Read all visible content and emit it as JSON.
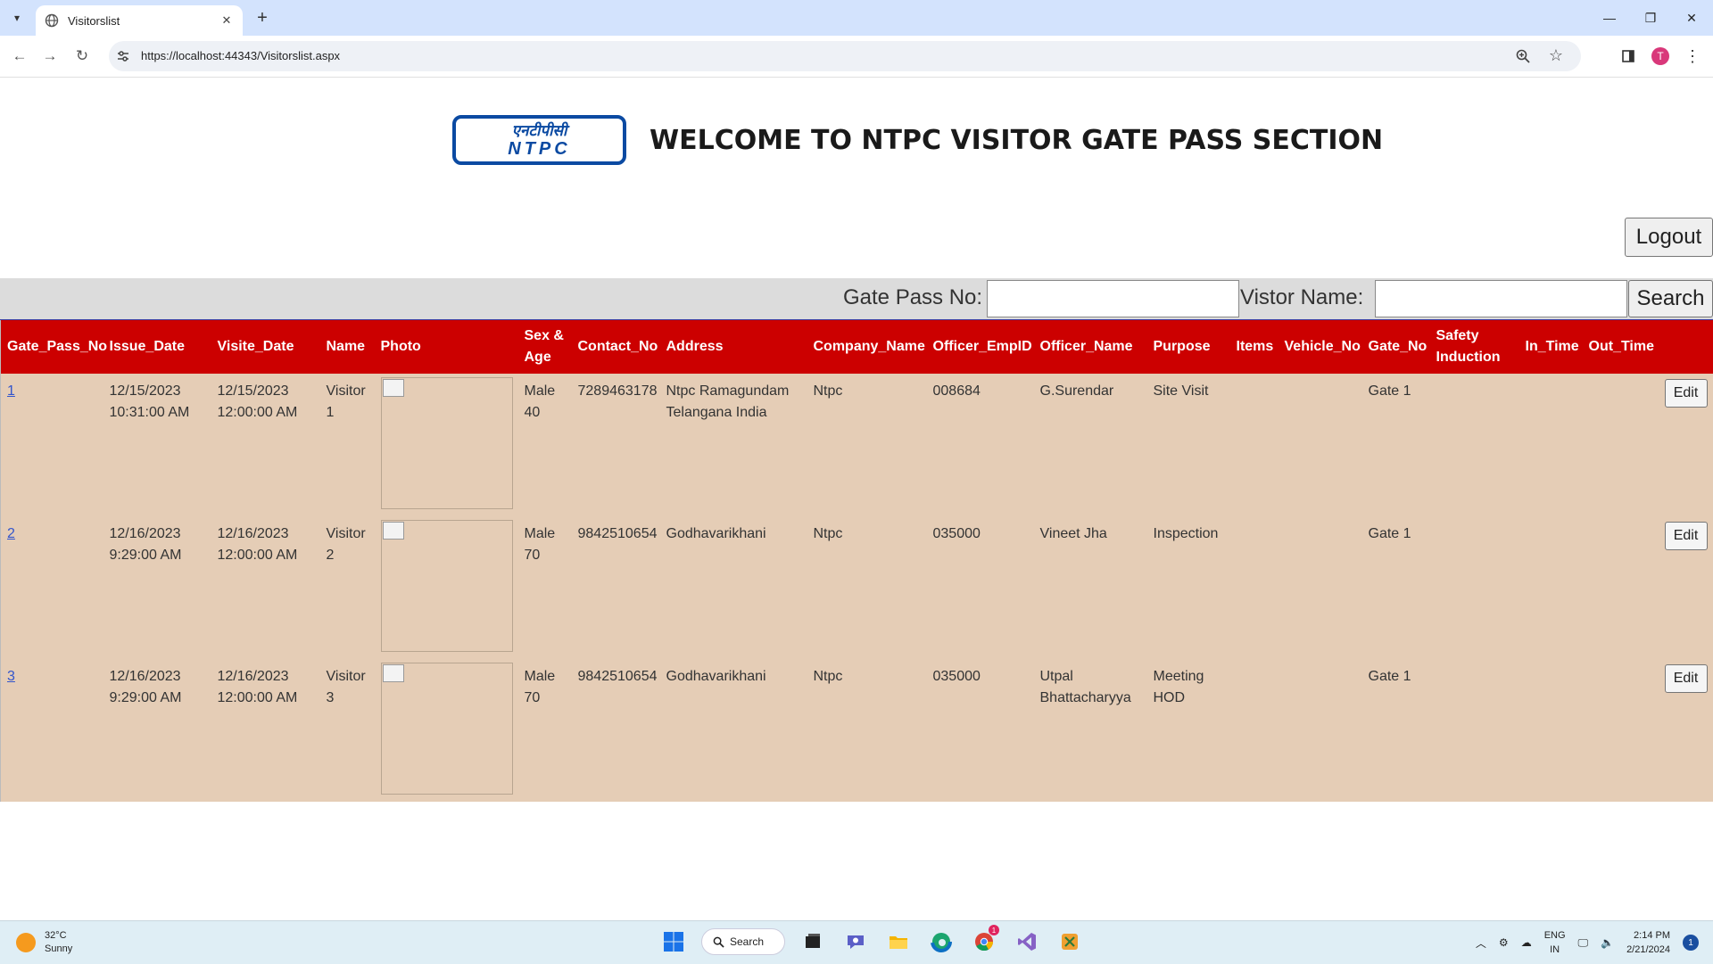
{
  "browser": {
    "tab_title": "Visitorslist",
    "url": "https://localhost:44343/Visitorslist.aspx",
    "avatar_letter": "T"
  },
  "header": {
    "logo_hindi": "एनटीपीसी",
    "logo_english": "NTPC",
    "title": "WELCOME TO NTPC VISITOR GATE PASS SECTION"
  },
  "logout_label": "Logout",
  "search": {
    "gate_pass_label": "Gate Pass No:",
    "gate_pass_value": "",
    "visitor_name_label": "Vistor Name:",
    "visitor_name_value": "",
    "search_label": "Search"
  },
  "table": {
    "columns": [
      "Gate_Pass_No",
      "Issue_Date",
      "Visite_Date",
      "Name",
      "Photo",
      "Sex & Age",
      "Contact_No",
      "Address",
      "Company_Name",
      "Officer_EmpID",
      "Officer_Name",
      "Purpose",
      "Items",
      "Vehicle_No",
      "Gate_No",
      "Safety Induction",
      "In_Time",
      "Out_Time",
      ""
    ],
    "edit_label": "Edit",
    "rows": [
      {
        "gate_pass_no": "1",
        "issue_date": "12/15/2023 10:31:00 AM",
        "visite_date": "12/15/2023 12:00:00 AM",
        "name": "Visitor 1",
        "sex_age": "Male 40",
        "contact_no": "7289463178",
        "address": "Ntpc Ramagundam Telangana India",
        "company_name": "Ntpc",
        "officer_empid": "008684",
        "officer_name": "G.Surendar",
        "purpose": "Site Visit",
        "items": "",
        "vehicle_no": "",
        "gate_no": "Gate 1",
        "safety_induction": "",
        "in_time": "",
        "out_time": ""
      },
      {
        "gate_pass_no": "2",
        "issue_date": "12/16/2023 9:29:00 AM",
        "visite_date": "12/16/2023 12:00:00 AM",
        "name": "Visitor 2",
        "sex_age": "Male 70",
        "contact_no": "9842510654",
        "address": "Godhavarikhani",
        "company_name": "Ntpc",
        "officer_empid": "035000",
        "officer_name": "Vineet Jha",
        "purpose": "Inspection",
        "items": "",
        "vehicle_no": "",
        "gate_no": "Gate 1",
        "safety_induction": "",
        "in_time": "",
        "out_time": ""
      },
      {
        "gate_pass_no": "3",
        "issue_date": "12/16/2023 9:29:00 AM",
        "visite_date": "12/16/2023 12:00:00 AM",
        "name": "Visitor 3",
        "sex_age": "Male 70",
        "contact_no": "9842510654",
        "address": "Godhavarikhani",
        "company_name": "Ntpc",
        "officer_empid": "035000",
        "officer_name": "Utpal Bhattacharyya",
        "purpose": "Meeting HOD",
        "items": "",
        "vehicle_no": "",
        "gate_no": "Gate 1",
        "safety_induction": "",
        "in_time": "",
        "out_time": ""
      }
    ]
  },
  "taskbar": {
    "weather_temp": "32°C",
    "weather_desc": "Sunny",
    "search_label": "Search",
    "lang_top": "ENG",
    "lang_bottom": "IN",
    "time": "2:14 PM",
    "date": "2/21/2024",
    "notification_count": "1",
    "chrome_badge": "1"
  }
}
